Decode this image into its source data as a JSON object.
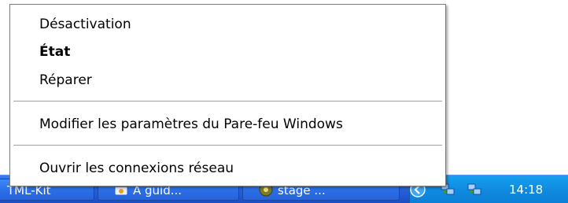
{
  "menu": {
    "items": [
      {
        "label": "Désactivation",
        "bold": false
      },
      {
        "label": "État",
        "bold": true
      },
      {
        "label": "Réparer",
        "bold": false
      },
      {
        "label": "Modifier les paramètres du Pare-feu Windows",
        "bold": false
      },
      {
        "label": "Ouvrir les connexions réseau",
        "bold": false
      }
    ]
  },
  "taskbar": {
    "buttons": [
      {
        "label": "TML-Kit",
        "icon": "none"
      },
      {
        "label": "A guid...",
        "icon": "browser-icon"
      },
      {
        "label": "stage ...",
        "icon": "media-icon"
      }
    ],
    "tray": {
      "icons": [
        "network-connection-icon",
        "network-connection-icon"
      ],
      "clock": "14:18"
    }
  },
  "colors": {
    "taskbar": "#245bd4",
    "tray": "#0f8be0",
    "menu_border": "#7c7c7c"
  }
}
